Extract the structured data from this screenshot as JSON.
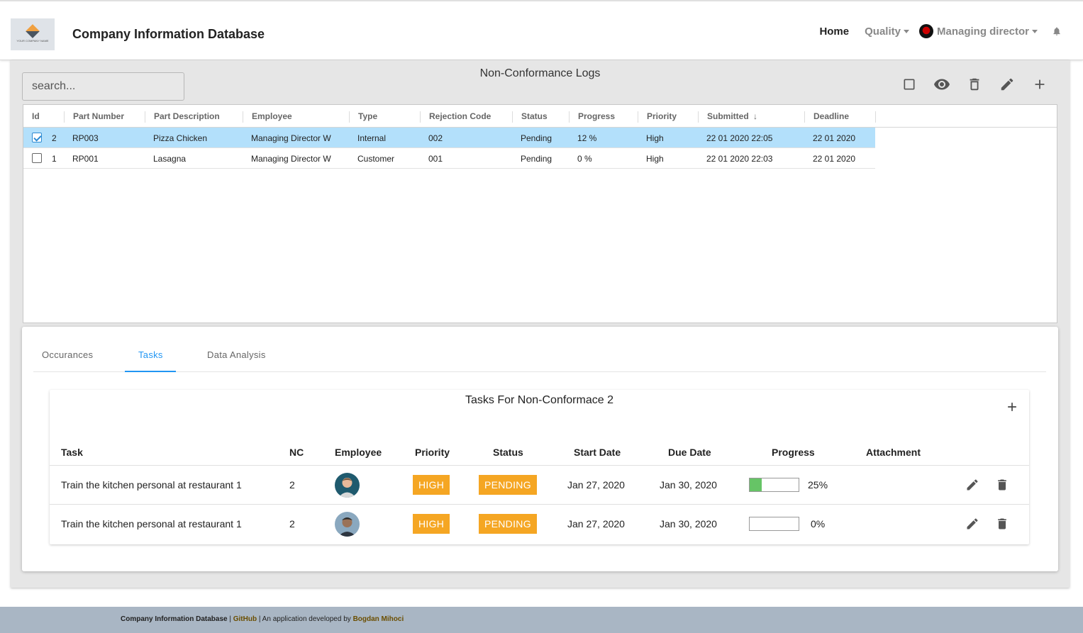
{
  "header": {
    "logo_text": "YOUR COMPANY NAME",
    "title": "Company Information Database",
    "nav_home": "Home",
    "nav_quality": "Quality",
    "user_name": "Managing director"
  },
  "grid": {
    "search_placeholder": "search...",
    "title": "Non-Conformance Logs",
    "columns": [
      "Id",
      "Part Number",
      "Part Description",
      "Employee",
      "Type",
      "Rejection Code",
      "Status",
      "Progress",
      "Priority",
      "Submitted",
      "Deadline"
    ],
    "sort_indicator": "↓",
    "rows": [
      {
        "id": "2",
        "part_number": "RP003",
        "part_description": "Pizza Chicken",
        "employee": "Managing Director W",
        "type": "Internal",
        "rejection_code": "002",
        "status": "Pending",
        "progress": "12 %",
        "priority": "High",
        "submitted": "22 01 2020 22:05",
        "deadline": "22 01 2020",
        "selected": true
      },
      {
        "id": "1",
        "part_number": "RP001",
        "part_description": "Lasagna",
        "employee": "Managing Director W",
        "type": "Customer",
        "rejection_code": "001",
        "status": "Pending",
        "progress": "0 %",
        "priority": "High",
        "submitted": "22 01 2020 22:03",
        "deadline": "22 01 2020",
        "selected": false
      }
    ]
  },
  "tabs": [
    {
      "label": "Occurances",
      "active": false
    },
    {
      "label": "Tasks",
      "active": true
    },
    {
      "label": "Data Analysis",
      "active": false
    }
  ],
  "tasks": {
    "title": "Tasks For Non-Conformace 2",
    "columns": [
      "Task",
      "NC",
      "Employee",
      "Priority",
      "Status",
      "Start Date",
      "Due Date",
      "Progress",
      "Attachment"
    ],
    "rows": [
      {
        "task": "Train the kitchen personal at restaurant 1",
        "nc": "2",
        "priority": "HIGH",
        "status": "PENDING",
        "start_date": "Jan 27, 2020",
        "due_date": "Jan 30, 2020",
        "progress": 25,
        "progress_label": "25%"
      },
      {
        "task": "Train the kitchen personal at restaurant 1",
        "nc": "2",
        "priority": "HIGH",
        "status": "PENDING",
        "start_date": "Jan 27, 2020",
        "due_date": "Jan 30, 2020",
        "progress": 0,
        "progress_label": "0%"
      }
    ]
  },
  "footer": {
    "app_name": "Company Information Database",
    "sep1": " | ",
    "github": "GitHub",
    "text": " | An application developed by ",
    "author": "Bogdan Mihoci"
  },
  "colors": {
    "accent": "#2196f3",
    "selected_row": "#b3e0fb",
    "badge": "#f5a623",
    "progress_fill": "#66c466",
    "footer_bg": "#a9b6c4"
  }
}
